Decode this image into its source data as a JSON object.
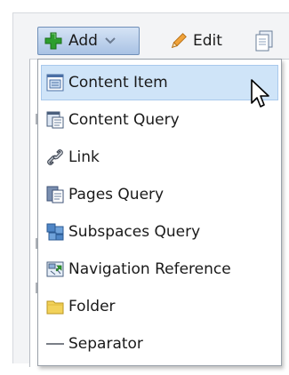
{
  "toolbar": {
    "add_label": "Add",
    "edit_label": "Edit"
  },
  "menu": {
    "items": [
      {
        "label": "Content Item",
        "icon": "content-item-icon",
        "selected": true
      },
      {
        "label": "Content Query",
        "icon": "content-query-icon"
      },
      {
        "label": "Link",
        "icon": "link-icon"
      },
      {
        "label": "Pages Query",
        "icon": "pages-query-icon"
      },
      {
        "label": "Subspaces Query",
        "icon": "subspaces-query-icon"
      },
      {
        "label": "Navigation Reference",
        "icon": "navigation-reference-icon"
      },
      {
        "label": "Folder",
        "icon": "folder-icon"
      },
      {
        "label": "Separator",
        "icon": "separator-icon"
      }
    ]
  },
  "colors": {
    "selected_bg": "#cfe4f8",
    "add_button_gradient_top": "#d5e3f5",
    "add_button_gradient_bottom": "#a9c2e4",
    "plus_green": "#2e9e2e",
    "folder_yellow": "#f2d25a"
  }
}
